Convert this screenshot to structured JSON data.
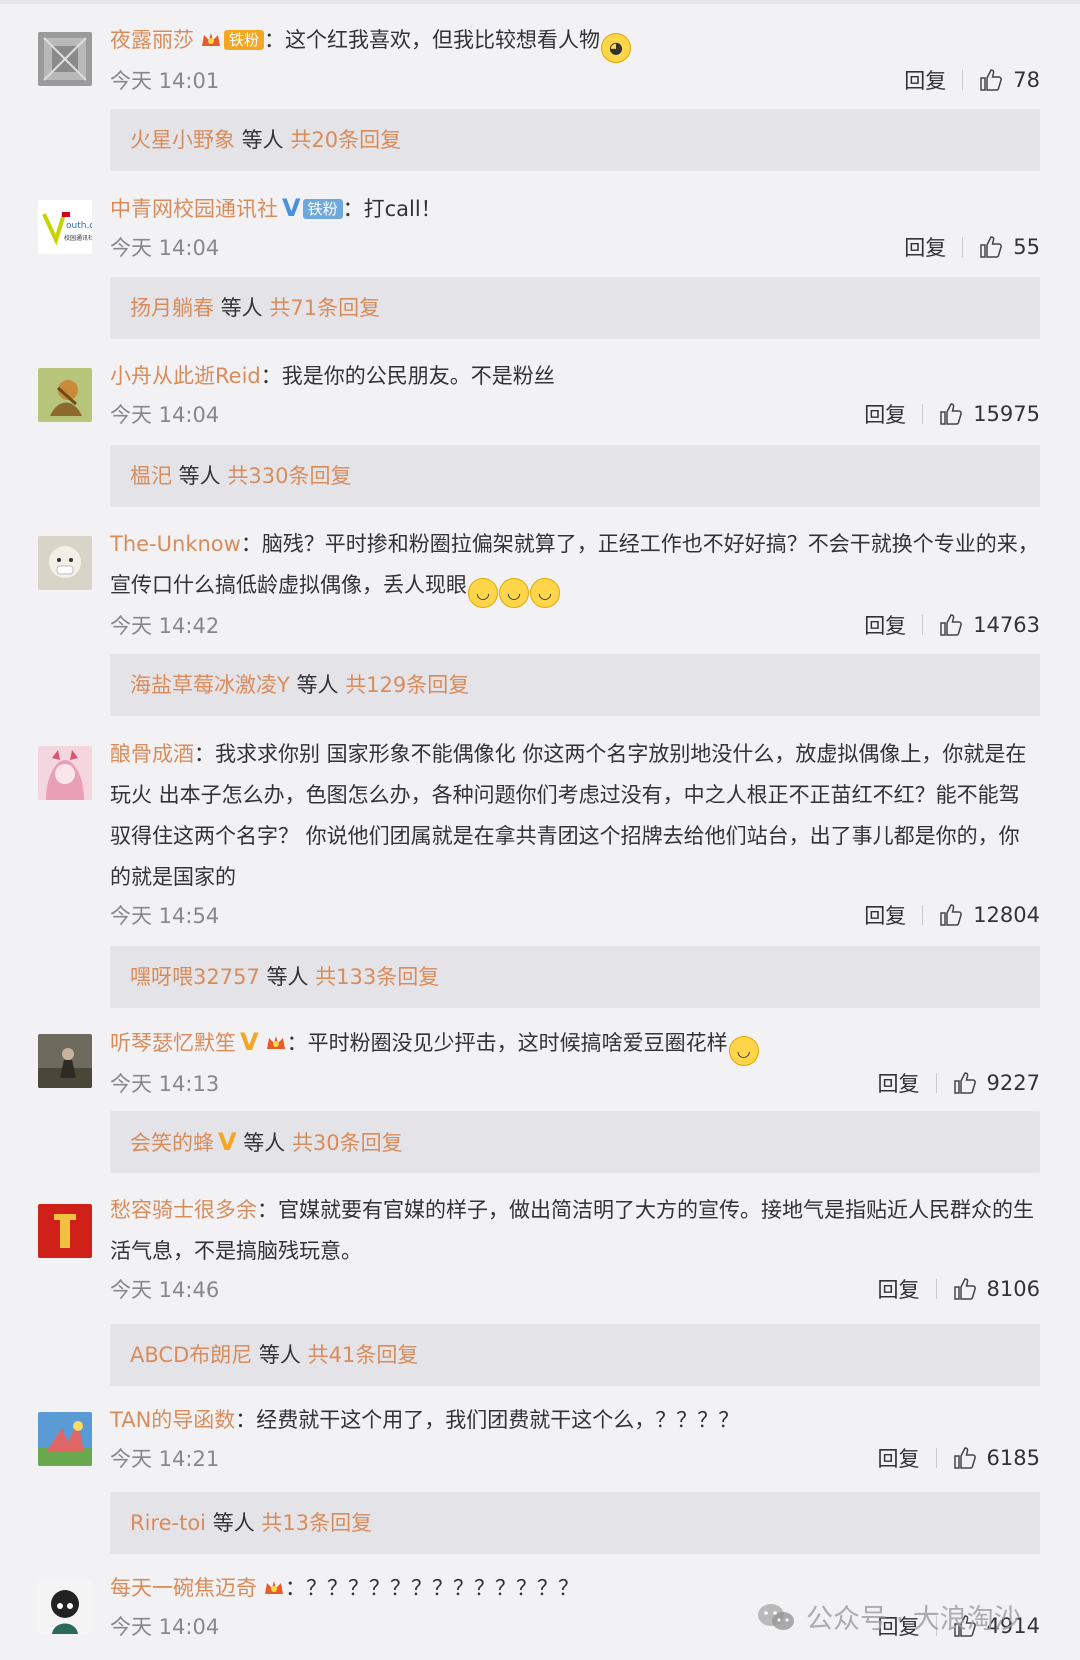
{
  "comments": [
    {
      "username": "夜露丽莎",
      "badges": [
        "crown-badge",
        "tiefen"
      ],
      "tiefen_label": "铁粉",
      "separator": "：",
      "text": "这个红我喜欢，但我比较想看人物",
      "emoji_count": 1,
      "time": "今天 14:01",
      "reply_label": "回复",
      "likes": "78",
      "reply_preview": {
        "name": "火星小野象",
        "mid": " 等人 ",
        "count": "共20条回复"
      }
    },
    {
      "username": "中青网校园通讯社",
      "badges": [
        "v-blue",
        "tiefen"
      ],
      "tiefen_label": "铁粉",
      "separator": "：",
      "text": "打call！",
      "time": "今天 14:04",
      "reply_label": "回复",
      "likes": "55",
      "reply_preview": {
        "name": "扬月躺春",
        "mid": " 等人 ",
        "count": "共71条回复"
      }
    },
    {
      "username": "小舟从此逝Reid",
      "separator": "：",
      "text": "我是你的公民朋友。不是粉丝",
      "time": "今天 14:04",
      "reply_label": "回复",
      "likes": "15975",
      "reply_preview": {
        "name": "榅汜",
        "mid": " 等人 ",
        "count": "共330条回复"
      }
    },
    {
      "username": "The-Unknow",
      "separator": "：",
      "text": "脑残？平时掺和粉圈拉偏架就算了，正经工作也不好好搞？不会干就换个专业的来，宣传口什么搞低龄虚拟偶像，丢人现眼",
      "emoji_count": 3,
      "time": "今天 14:42",
      "reply_label": "回复",
      "likes": "14763",
      "reply_preview": {
        "name": "海盐草莓冰激凌Y",
        "mid": " 等人 ",
        "count": "共129条回复"
      }
    },
    {
      "username": "酿骨成酒",
      "separator": "：",
      "text": "我求求你别 国家形象不能偶像化 你这两个名字放别地没什么，放虚拟偶像上，你就是在玩火 出本子怎么办，色图怎么办，各种问题你们考虑过没有，中之人根正不正苗红不红？能不能驾驭得住这两个名字？ 你说他们团属就是在拿共青团这个招牌去给他们站台，出了事儿都是你的，你的就是国家的",
      "time": "今天 14:54",
      "reply_label": "回复",
      "likes": "12804",
      "reply_preview": {
        "name": "嘿呀喂32757",
        "mid": " 等人 ",
        "count": "共133条回复"
      }
    },
    {
      "username": "听琴瑟忆默笙",
      "badges": [
        "v-gold",
        "crown-badge"
      ],
      "separator": "：",
      "text": "平时粉圈没见少抨击，这时候搞啥爱豆圈花样",
      "emoji_count": 1,
      "time": "今天 14:13",
      "reply_label": "回复",
      "likes": "9227",
      "reply_preview": {
        "name": "会笑的蜂",
        "name_badge": "V",
        "mid": " 等人 ",
        "count": "共30条回复"
      }
    },
    {
      "username": "愁容骑士很多余",
      "separator": "：",
      "text": "官媒就要有官媒的样子，做出简洁明了大方的宣传。接地气是指贴近人民群众的生活气息，不是搞脑残玩意。",
      "time": "今天 14:46",
      "reply_label": "回复",
      "likes": "8106",
      "reply_preview": {
        "name": "ABCD布朗尼",
        "mid": " 等人 ",
        "count": "共41条回复"
      }
    },
    {
      "username": "TAN的导函数",
      "separator": "：",
      "text": "经费就干这个用了，我们团费就干这个么，？？？？",
      "time": "今天 14:21",
      "reply_label": "回复",
      "likes": "6185",
      "reply_preview": {
        "name": "Rire-toi",
        "mid": " 等人 ",
        "count": "共13条回复"
      }
    },
    {
      "username": "每天一碗焦迈奇",
      "badges": [
        "crown-badge"
      ],
      "separator": "：",
      "text": "？？？？？？？？？？？？？",
      "time": "今天 14:04",
      "reply_label": "回复",
      "likes": "4914"
    }
  ],
  "watermark": {
    "text": "公众号 · 大浪淘沙",
    "icon": "wechat-icon"
  },
  "colors": {
    "username": "#d98c5b",
    "v_gold": "#f5a623",
    "v_blue": "#4a90e2",
    "reply_bg": "#e4e4e8"
  }
}
